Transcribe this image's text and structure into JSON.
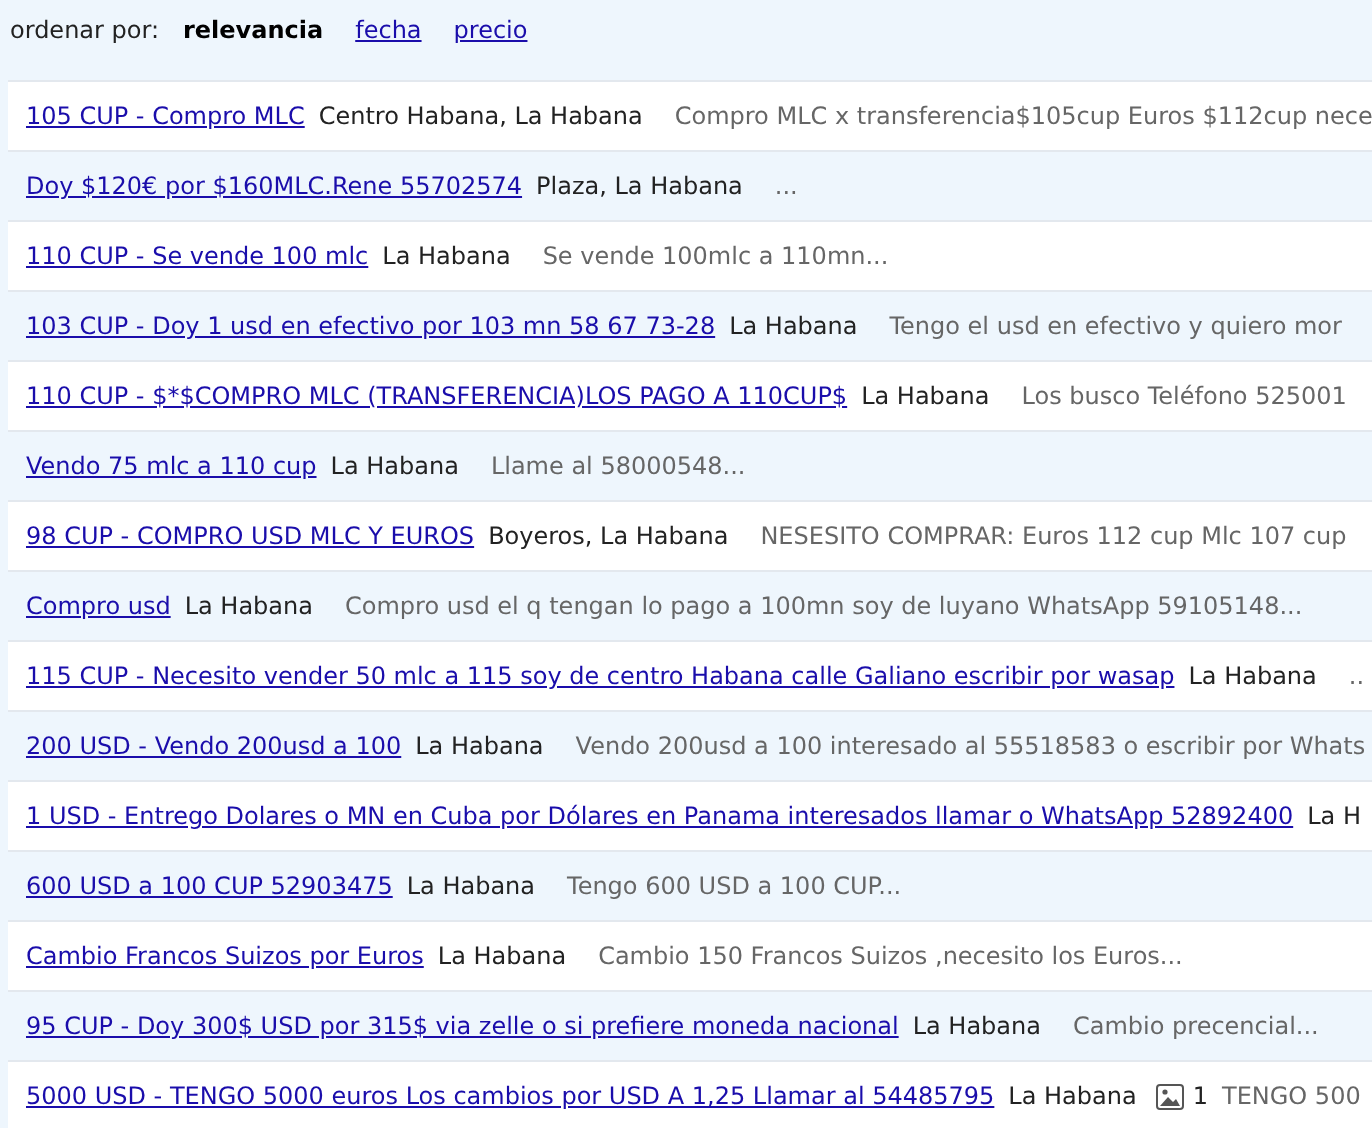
{
  "sort": {
    "label": "ordenar por:",
    "options": [
      {
        "label": "relevancia",
        "selected": true
      },
      {
        "label": "fecha",
        "selected": false
      },
      {
        "label": "precio",
        "selected": false
      }
    ]
  },
  "listings": [
    {
      "title": "105 CUP - Compro MLC",
      "location": "Centro Habana, La Habana",
      "description": "Compro MLC x transferencia$105cup Euros $112cup nece"
    },
    {
      "title": "Doy $120€ por $160MLC.Rene 55702574",
      "location": "Plaza, La Habana",
      "description": "..."
    },
    {
      "title": "110 CUP - Se vende 100 mlc",
      "location": "La Habana",
      "description": "Se vende 100mlc a 110mn..."
    },
    {
      "title": "103 CUP - Doy 1 usd en efectivo por 103 mn 58  67  73-28",
      "location": "La Habana",
      "description": "Tengo el usd en efectivo y quiero mor"
    },
    {
      "title": "110 CUP - $*$COMPRO MLC (TRANSFERENCIA)LOS PAGO A 110CUP$",
      "location": "La Habana",
      "description": "Los busco Teléfono 525001"
    },
    {
      "title": "Vendo 75 mlc a 110 cup",
      "location": "La Habana",
      "description": "Llame al 58000548..."
    },
    {
      "title": "98 CUP - COMPRO USD MLC Y EUROS",
      "location": "Boyeros, La Habana",
      "description": "NESESITO COMPRAR: Euros 112 cup Mlc 107 cup"
    },
    {
      "title": "Compro usd",
      "location": "La Habana",
      "description": "Compro usd el q tengan lo pago a 100mn soy de luyano WhatsApp 59105148..."
    },
    {
      "title": "115 CUP - Necesito vender 50 mlc a 115 soy de centro Habana calle Galiano escribir por wasap",
      "location": "La Habana",
      "description": ".."
    },
    {
      "title": "200 USD - Vendo 200usd a 100",
      "location": "La Habana",
      "description": "Vendo 200usd a 100 interesado al 55518583 o escribir por Whats"
    },
    {
      "title": "1 USD - Entrego Dolares o MN en Cuba por Dólares en Panama interesados llamar o WhatsApp 52892400",
      "location": "La H"
    },
    {
      "title": "600 USD a 100 CUP 52903475",
      "location": "La Habana",
      "description": "Tengo 600 USD a 100 CUP..."
    },
    {
      "title": "Cambio Francos Suizos por Euros",
      "location": "La Habana",
      "description": "Cambio 150 Francos Suizos ,necesito los Euros..."
    },
    {
      "title": "95 CUP - Doy 300$ USD por 315$ via zelle o si prefiere moneda nacional",
      "location": "La Habana",
      "description": "Cambio precencial..."
    },
    {
      "title": "5000 USD - TENGO 5000 euros Los cambios por USD A 1,25 Llamar al 54485795",
      "location": "La Habana",
      "photos": "1",
      "description": "TENGO 500"
    }
  ]
}
